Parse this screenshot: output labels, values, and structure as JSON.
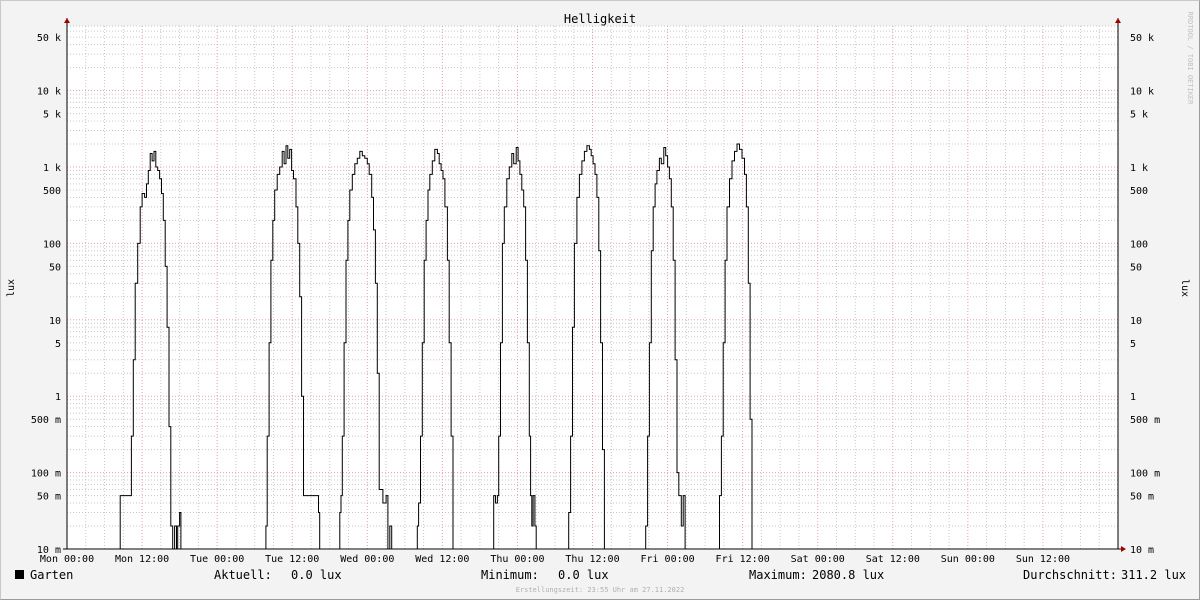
{
  "chart_data": {
    "type": "line",
    "title": "Helligkeit",
    "ylabel": "lux",
    "yscale": "log",
    "ylim": [
      0.01,
      70000
    ],
    "y_ticks": [
      {
        "value": 50000,
        "label": "50 k"
      },
      {
        "value": 10000,
        "label": "10 k"
      },
      {
        "value": 5000,
        "label": "5 k"
      },
      {
        "value": 1000,
        "label": "1 k"
      },
      {
        "value": 500,
        "label": "500"
      },
      {
        "value": 100,
        "label": "100"
      },
      {
        "value": 50,
        "label": "50"
      },
      {
        "value": 10,
        "label": "10"
      },
      {
        "value": 5,
        "label": "5"
      },
      {
        "value": 1,
        "label": "1"
      },
      {
        "value": 0.5,
        "label": "500 m"
      },
      {
        "value": 0.1,
        "label": "100 m"
      },
      {
        "value": 0.05,
        "label": "50 m"
      },
      {
        "value": 0.01,
        "label": "10 m"
      }
    ],
    "x_ticks": [
      "Mon 00:00",
      "Mon 12:00",
      "Tue 00:00",
      "Tue 12:00",
      "Wed 00:00",
      "Wed 12:00",
      "Thu 00:00",
      "Thu 12:00",
      "Fri 00:00",
      "Fri 12:00",
      "Sat 00:00",
      "Sat 12:00",
      "Sun 00:00",
      "Sun 12:00"
    ],
    "xlim_hours": [
      0,
      168
    ],
    "x_unit": "hours since Mon 00:00",
    "grid": true,
    "colors": {
      "line": "#000000",
      "major_grid": "#e8a0a8",
      "minor_grid": "#c8c8c8",
      "axis": "#000000",
      "arrow": "#a00000",
      "plot_bg": "#ffffff"
    },
    "series": [
      {
        "name": "Garten",
        "color": "#000000",
        "points": [
          [
            8.0,
            0
          ],
          [
            8.5,
            0.05
          ],
          [
            10.0,
            0.05
          ],
          [
            10.3,
            0.3
          ],
          [
            10.6,
            3
          ],
          [
            10.9,
            30
          ],
          [
            11.3,
            100
          ],
          [
            11.7,
            300
          ],
          [
            12.0,
            450
          ],
          [
            12.4,
            400
          ],
          [
            12.7,
            600
          ],
          [
            13.0,
            900
          ],
          [
            13.3,
            1500
          ],
          [
            13.6,
            1200
          ],
          [
            13.9,
            1600
          ],
          [
            14.2,
            1000
          ],
          [
            14.5,
            900
          ],
          [
            14.8,
            700
          ],
          [
            15.1,
            450
          ],
          [
            15.4,
            200
          ],
          [
            15.7,
            50
          ],
          [
            16.0,
            8
          ],
          [
            16.3,
            0.4
          ],
          [
            16.6,
            0.02
          ],
          [
            16.9,
            0
          ],
          [
            17.2,
            0.02
          ],
          [
            17.5,
            0
          ],
          [
            17.7,
            0.02
          ],
          [
            18.0,
            0.03
          ],
          [
            18.2,
            0
          ],
          [
            31.6,
            0
          ],
          [
            31.8,
            0.02
          ],
          [
            32.0,
            0.3
          ],
          [
            32.3,
            5
          ],
          [
            32.6,
            60
          ],
          [
            32.9,
            200
          ],
          [
            33.2,
            500
          ],
          [
            33.6,
            800
          ],
          [
            34.0,
            1000
          ],
          [
            34.4,
            1600
          ],
          [
            34.7,
            1100
          ],
          [
            35.0,
            1900
          ],
          [
            35.3,
            1300
          ],
          [
            35.6,
            1700
          ],
          [
            35.9,
            900
          ],
          [
            36.2,
            700
          ],
          [
            36.6,
            300
          ],
          [
            36.9,
            100
          ],
          [
            37.2,
            20
          ],
          [
            37.5,
            1
          ],
          [
            37.8,
            0.05
          ],
          [
            40.0,
            0.05
          ],
          [
            40.2,
            0.03
          ],
          [
            40.4,
            0
          ],
          [
            43.3,
            0
          ],
          [
            43.6,
            0.03
          ],
          [
            43.8,
            0.05
          ],
          [
            44.0,
            0.3
          ],
          [
            44.3,
            5
          ],
          [
            44.6,
            60
          ],
          [
            44.9,
            200
          ],
          [
            45.2,
            500
          ],
          [
            45.6,
            800
          ],
          [
            46.0,
            1100
          ],
          [
            46.4,
            1300
          ],
          [
            46.8,
            1600
          ],
          [
            47.2,
            1400
          ],
          [
            47.6,
            1300
          ],
          [
            48.0,
            1100
          ],
          [
            48.3,
            800
          ],
          [
            48.7,
            400
          ],
          [
            49.0,
            150
          ],
          [
            49.3,
            30
          ],
          [
            49.6,
            2
          ],
          [
            49.9,
            0.06
          ],
          [
            50.5,
            0.04
          ],
          [
            51.0,
            0.05
          ],
          [
            51.3,
            0
          ],
          [
            51.6,
            0.02
          ],
          [
            51.9,
            0
          ],
          [
            55.8,
            0
          ],
          [
            56.0,
            0.02
          ],
          [
            56.2,
            0.04
          ],
          [
            56.5,
            0.3
          ],
          [
            56.8,
            5
          ],
          [
            57.1,
            60
          ],
          [
            57.4,
            200
          ],
          [
            57.7,
            500
          ],
          [
            58.0,
            800
          ],
          [
            58.4,
            1200
          ],
          [
            58.8,
            1700
          ],
          [
            59.2,
            1500
          ],
          [
            59.5,
            1100
          ],
          [
            59.8,
            900
          ],
          [
            60.1,
            700
          ],
          [
            60.4,
            300
          ],
          [
            60.8,
            60
          ],
          [
            61.1,
            5
          ],
          [
            61.4,
            0.3
          ],
          [
            61.7,
            0
          ],
          [
            68.0,
            0
          ],
          [
            68.2,
            0.05
          ],
          [
            68.5,
            0.04
          ],
          [
            68.8,
            0.05
          ],
          [
            69.0,
            0.3
          ],
          [
            69.3,
            5
          ],
          [
            69.6,
            100
          ],
          [
            69.9,
            300
          ],
          [
            70.3,
            700
          ],
          [
            70.7,
            1000
          ],
          [
            71.1,
            1500
          ],
          [
            71.4,
            1100
          ],
          [
            71.8,
            1800
          ],
          [
            72.1,
            1200
          ],
          [
            72.4,
            800
          ],
          [
            72.7,
            500
          ],
          [
            73.0,
            300
          ],
          [
            73.3,
            60
          ],
          [
            73.6,
            5
          ],
          [
            73.9,
            0.3
          ],
          [
            74.1,
            0.05
          ],
          [
            74.3,
            0.02
          ],
          [
            74.5,
            0.05
          ],
          [
            74.8,
            0.02
          ],
          [
            75.0,
            0
          ],
          [
            79.8,
            0
          ],
          [
            80.2,
            0.03
          ],
          [
            80.5,
            0.3
          ],
          [
            80.8,
            8
          ],
          [
            81.1,
            100
          ],
          [
            81.5,
            400
          ],
          [
            81.9,
            800
          ],
          [
            82.3,
            1200
          ],
          [
            82.7,
            1600
          ],
          [
            83.1,
            1900
          ],
          [
            83.5,
            1700
          ],
          [
            83.8,
            1400
          ],
          [
            84.1,
            1100
          ],
          [
            84.4,
            800
          ],
          [
            84.7,
            400
          ],
          [
            85.0,
            80
          ],
          [
            85.3,
            5
          ],
          [
            85.6,
            0.2
          ],
          [
            85.9,
            0
          ],
          [
            92.2,
            0
          ],
          [
            92.5,
            0.02
          ],
          [
            92.8,
            0.3
          ],
          [
            93.1,
            5
          ],
          [
            93.4,
            80
          ],
          [
            93.7,
            300
          ],
          [
            94.0,
            600
          ],
          [
            94.3,
            900
          ],
          [
            94.7,
            1300
          ],
          [
            95.0,
            1100
          ],
          [
            95.4,
            1800
          ],
          [
            95.7,
            1400
          ],
          [
            96.0,
            1000
          ],
          [
            96.3,
            700
          ],
          [
            96.6,
            300
          ],
          [
            96.9,
            60
          ],
          [
            97.2,
            3
          ],
          [
            97.5,
            0.1
          ],
          [
            97.8,
            0.05
          ],
          [
            98.2,
            0.02
          ],
          [
            98.5,
            0.05
          ],
          [
            98.8,
            0
          ],
          [
            104.0,
            0
          ],
          [
            104.3,
            0.05
          ],
          [
            104.6,
            0.3
          ],
          [
            104.9,
            5
          ],
          [
            105.2,
            60
          ],
          [
            105.5,
            300
          ],
          [
            105.9,
            700
          ],
          [
            106.3,
            1200
          ],
          [
            106.7,
            1600
          ],
          [
            107.1,
            2000
          ],
          [
            107.5,
            1700
          ],
          [
            107.9,
            1300
          ],
          [
            108.3,
            800
          ],
          [
            108.6,
            300
          ],
          [
            108.9,
            30
          ],
          [
            109.2,
            0.5
          ],
          [
            109.5,
            0
          ]
        ]
      }
    ],
    "legend": {
      "series_name": "Garten",
      "current_label": "Aktuell:",
      "current_value": "0.0 lux",
      "min_label": "Minimum:",
      "min_value": "0.0 lux",
      "max_label": "Maximum:",
      "max_value": "2080.8 lux",
      "avg_label": "Durchschnitt:",
      "avg_value": "311.2 lux"
    },
    "footer": "Erstellungszeit: 23:55 Uhr am 27.11.2022",
    "watermark": "RRDTOOL / TOBI OETIKER"
  }
}
